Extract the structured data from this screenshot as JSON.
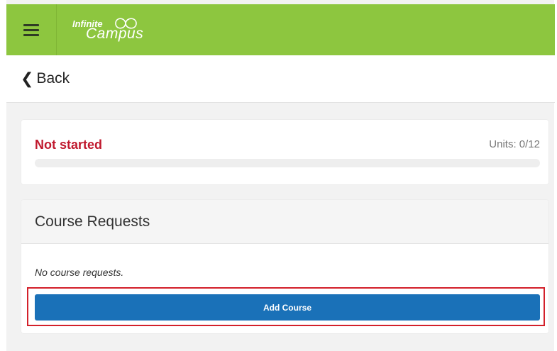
{
  "brand": {
    "line1": "Infinite",
    "line2": "Campus",
    "color": "#8dc63f"
  },
  "nav": {
    "menu_icon": "hamburger-menu-icon",
    "back_label": "Back",
    "back_icon": "chevron-left-icon"
  },
  "status": {
    "label": "Not started",
    "units": "Units: 0/12",
    "progress_fraction": 0,
    "status_color": "#c0192e"
  },
  "requests": {
    "title": "Course Requests",
    "empty_message": "No course requests.",
    "add_button_label": "Add Course",
    "button_color": "#1a71b8",
    "highlight_color": "#d3202a"
  }
}
